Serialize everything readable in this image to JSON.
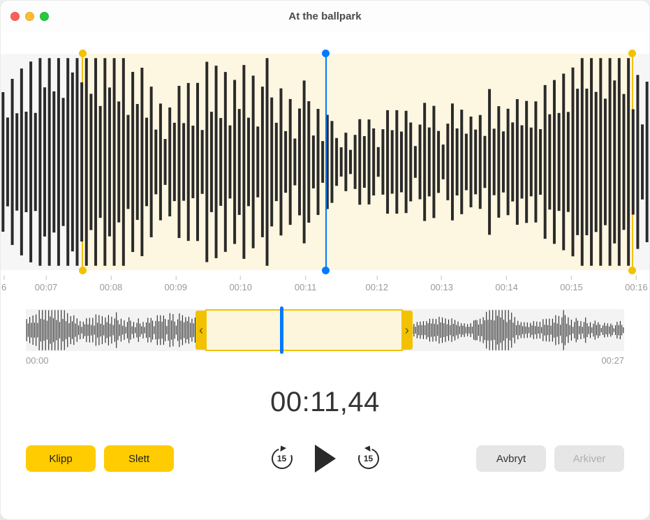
{
  "window": {
    "title": "At the ballpark"
  },
  "main_wave": {
    "selection_start_pct": 12.5,
    "selection_end_pct": 97.5,
    "playhead_pct": 50,
    "ticks": [
      {
        "label": "6",
        "pct": 0.5
      },
      {
        "label": "00:07",
        "pct": 7
      },
      {
        "label": "00:08",
        "pct": 17
      },
      {
        "label": "00:09",
        "pct": 27
      },
      {
        "label": "00:10",
        "pct": 37
      },
      {
        "label": "00:11",
        "pct": 47
      },
      {
        "label": "00:12",
        "pct": 58
      },
      {
        "label": "00:13",
        "pct": 68
      },
      {
        "label": "00:14",
        "pct": 78
      },
      {
        "label": "00:15",
        "pct": 88
      },
      {
        "label": "00:16",
        "pct": 98
      }
    ]
  },
  "overview": {
    "start_label": "00:00",
    "end_label": "00:27",
    "selection_start_pct": 30,
    "selection_end_pct": 63,
    "playhead_pct": 42.5
  },
  "timecode": "00:11,44",
  "buttons": {
    "trim": "Klipp",
    "delete": "Slett",
    "skip_label": "15",
    "cancel": "Avbryt",
    "save": "Arkiver"
  }
}
